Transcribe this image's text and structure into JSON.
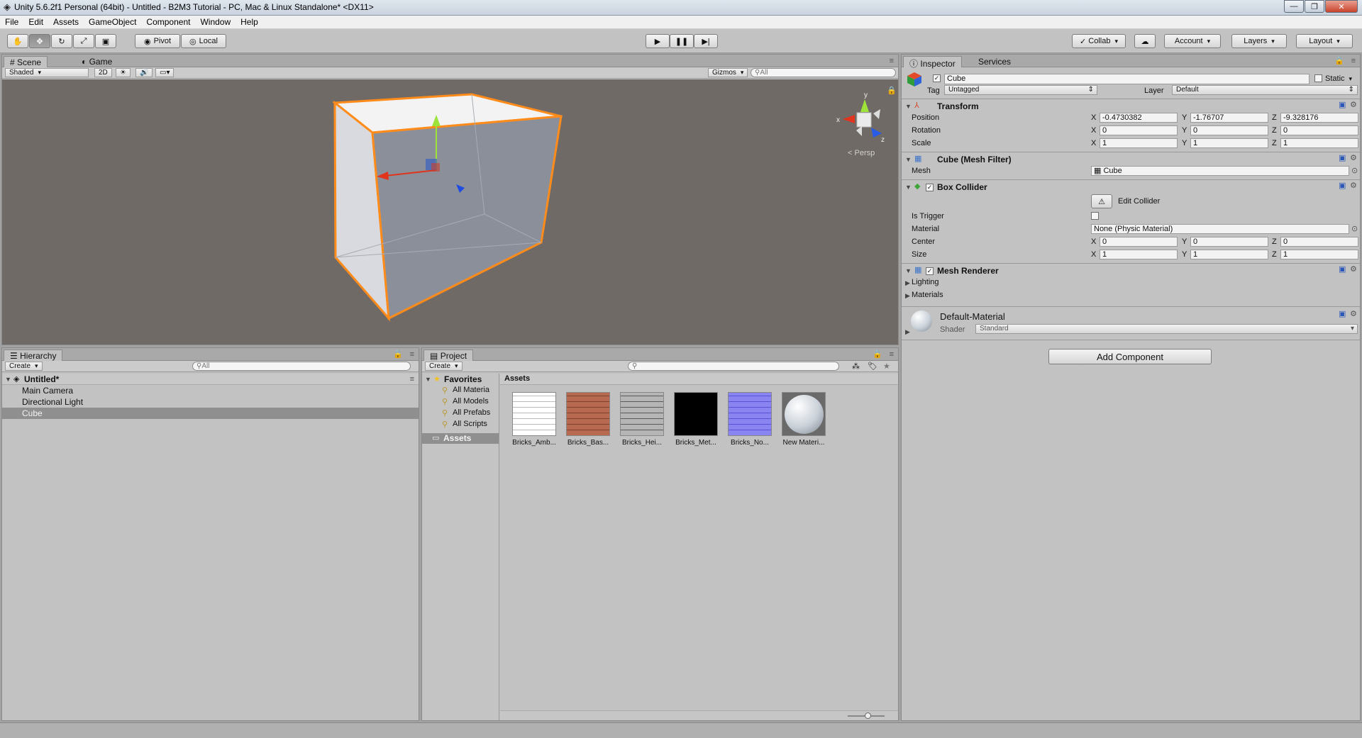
{
  "window": {
    "title": "Unity 5.6.2f1 Personal (64bit) - Untitled - B2M3 Tutorial - PC, Mac & Linux Standalone* <DX11>",
    "minimize": "—",
    "maximize": "❐",
    "close": "✕"
  },
  "menu": [
    "File",
    "Edit",
    "Assets",
    "GameObject",
    "Component",
    "Window",
    "Help"
  ],
  "toolbar": {
    "pivot": "Pivot",
    "local": "Local",
    "collab": "Collab",
    "account": "Account",
    "layers": "Layers",
    "layout": "Layout"
  },
  "scene": {
    "tabs": [
      "Scene",
      "Game"
    ],
    "shading": "Shaded",
    "mode2d": "2D",
    "gizmos": "Gizmos",
    "search": "All",
    "persp": "Persp",
    "gizmo_axes": {
      "x": "x",
      "y": "y",
      "z": "z"
    }
  },
  "hierarchy": {
    "tab": "Hierarchy",
    "create": "Create",
    "search": "All",
    "scene": "Untitled*",
    "items": [
      "Main Camera",
      "Directional Light",
      "Cube"
    ]
  },
  "project": {
    "tab": "Project",
    "create": "Create",
    "favorites": "Favorites",
    "fav_items": [
      "All Materia",
      "All Models",
      "All Prefabs",
      "All Scripts"
    ],
    "assets_folder": "Assets",
    "assets_header": "Assets",
    "assets": [
      "Bricks_Amb...",
      "Bricks_Bas...",
      "Bricks_Hei...",
      "Bricks_Met...",
      "Bricks_No...",
      "New Materi..."
    ]
  },
  "inspector": {
    "tabs": [
      "Inspector",
      "Services"
    ],
    "object_name": "Cube",
    "static": "Static",
    "tag_label": "Tag",
    "tag": "Untagged",
    "layer_label": "Layer",
    "layer": "Default",
    "transform": {
      "title": "Transform",
      "position_label": "Position",
      "rotation_label": "Rotation",
      "scale_label": "Scale",
      "position": [
        "-0.4730382",
        "-1.76707",
        "-9.328176"
      ],
      "rotation": [
        "0",
        "0",
        "0"
      ],
      "scale": [
        "1",
        "1",
        "1"
      ]
    },
    "mesh_filter": {
      "title": "Cube (Mesh Filter)",
      "mesh_label": "Mesh",
      "mesh": "Cube"
    },
    "box_collider": {
      "title": "Box Collider",
      "edit": "Edit Collider",
      "is_trigger_label": "Is Trigger",
      "material_label": "Material",
      "material": "None (Physic Material)",
      "center_label": "Center",
      "center": [
        "0",
        "0",
        "0"
      ],
      "size_label": "Size",
      "size": [
        "1",
        "1",
        "1"
      ]
    },
    "mesh_renderer": {
      "title": "Mesh Renderer",
      "lighting": "Lighting",
      "materials": "Materials"
    },
    "material": {
      "name": "Default-Material",
      "shader_label": "Shader",
      "shader": "Standard"
    },
    "add_component": "Add Component",
    "axis_labels": [
      "X",
      "Y",
      "Z"
    ]
  }
}
